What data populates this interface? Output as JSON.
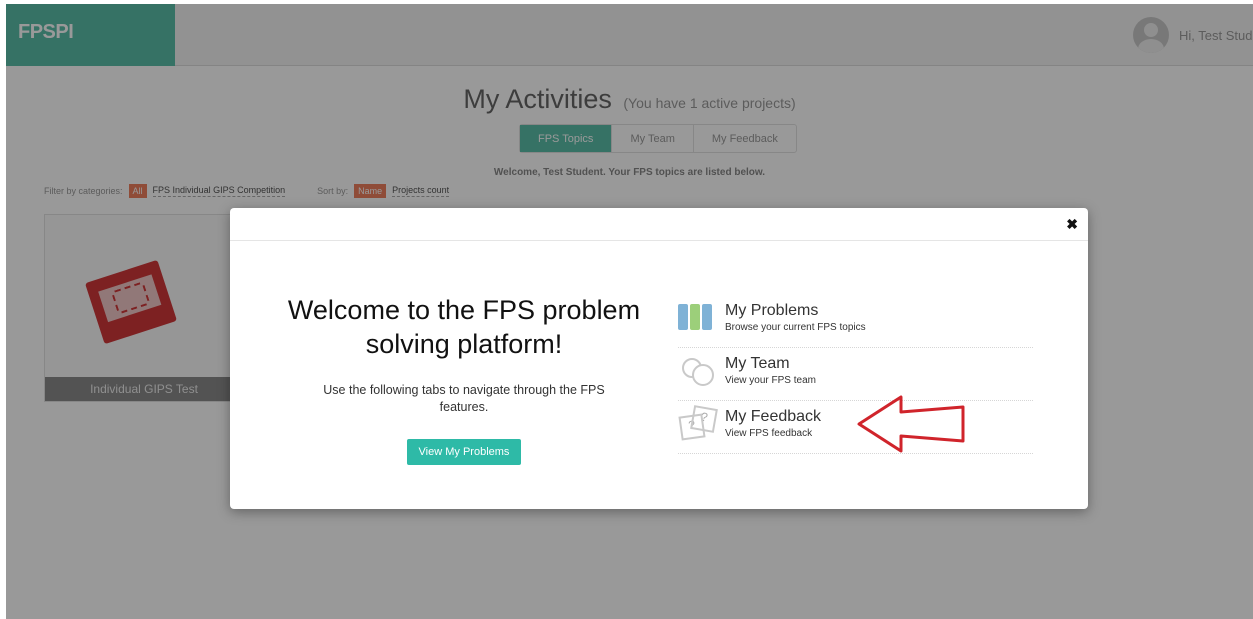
{
  "header": {
    "logo": "FPSPI",
    "greeting": "Hi, Test Stude"
  },
  "page": {
    "title": "My Activities",
    "subtitle": "(You have 1 active projects)",
    "tabs": [
      {
        "label": "FPS Topics",
        "active": true
      },
      {
        "label": "My Team",
        "active": false
      },
      {
        "label": "My Feedback",
        "active": false
      }
    ],
    "welcome_line": "Welcome, Test Student. Your FPS topics are listed below.",
    "filter": {
      "label": "Filter by categories:",
      "all": "All",
      "category": "FPS Individual GIPS Competition",
      "sort_label": "Sort by:",
      "sort_name": "Name",
      "sort_count": "Projects count"
    },
    "card": {
      "label": "Individual GIPS Test"
    }
  },
  "modal": {
    "title": "Welcome to the FPS problem solving platform!",
    "description": "Use the following tabs to navigate through the FPS features.",
    "button": "View My Problems",
    "close_icon": "close-icon",
    "features": [
      {
        "title": "My Problems",
        "subtitle": "Browse your current FPS topics",
        "icon": "problems-icon"
      },
      {
        "title": "My Team",
        "subtitle": "View your FPS team",
        "icon": "team-icon"
      },
      {
        "title": "My Feedback",
        "subtitle": "View FPS feedback",
        "icon": "feedback-icon"
      }
    ]
  },
  "colors": {
    "brand": "#5bbfa9",
    "button": "#2ebaa7",
    "chip": "#ef7f5e",
    "arrow": "#d0242b"
  }
}
